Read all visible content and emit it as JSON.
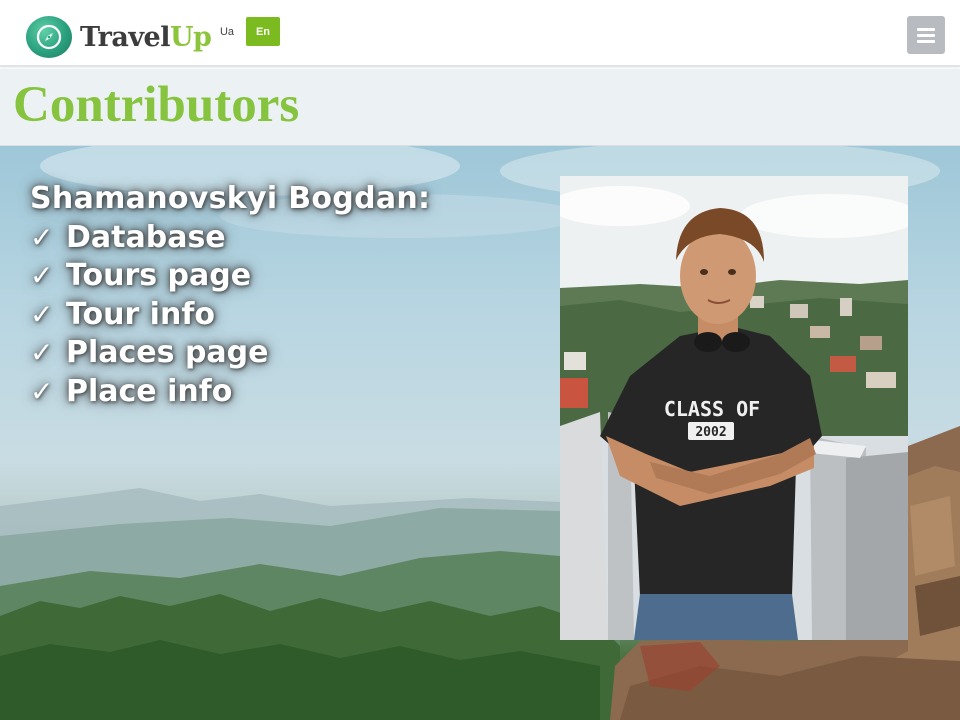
{
  "brand": {
    "name_part1": "Travel",
    "name_part2": "Up"
  },
  "languages": {
    "ua": "Ua",
    "en": "En",
    "active": "En"
  },
  "colors": {
    "accent": "#86c440",
    "active_lang_bg": "#7cbb1f",
    "menu_bg": "#b8bcc0"
  },
  "icons": {
    "logo": "compass-icon",
    "menu": "hamburger-icon",
    "check": "checkmark-icon"
  },
  "page": {
    "title": "Contributors"
  },
  "contributor": {
    "name": "Shamanovskyi Bogdan:",
    "check_glyph": "✓",
    "tasks": [
      "Database",
      "Tours page",
      "Tour info",
      "Places page",
      "Place info"
    ],
    "shirt_line1": "CLASS OF",
    "shirt_line2": "2002"
  }
}
